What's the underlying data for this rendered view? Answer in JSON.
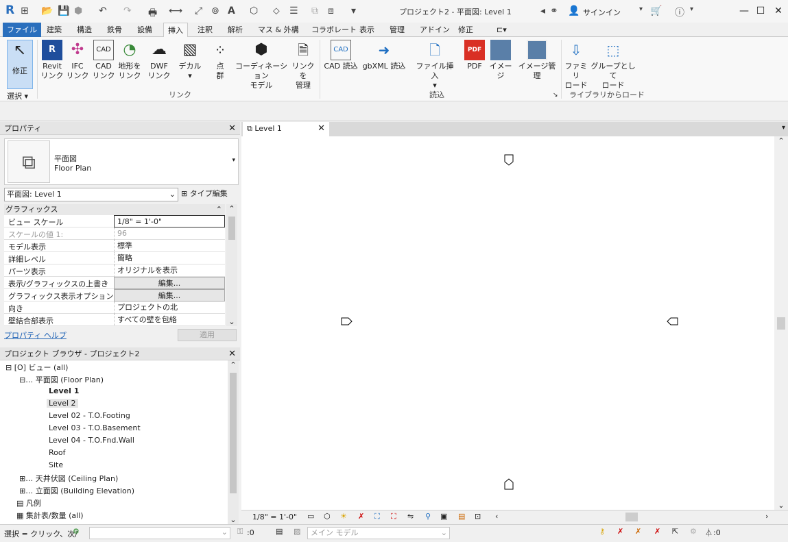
{
  "app": {
    "title": "プロジェクト2 - 平面図: Level 1",
    "signin": "サインイン",
    "logo": "R"
  },
  "tabs": [
    "ファイル",
    "建築",
    "構造",
    "鉄骨",
    "設備",
    "挿入",
    "注釈",
    "解析",
    "マス & 外構",
    "コラボレート",
    "表示",
    "管理",
    "アドイン",
    "修正"
  ],
  "ribbon": {
    "modify": "修正",
    "select": "選択",
    "links": [
      {
        "l1": "Revit",
        "l2": "リンク"
      },
      {
        "l1": "IFC",
        "l2": "リンク"
      },
      {
        "l1": "CAD",
        "l2": "リンク"
      },
      {
        "l1": "地形を",
        "l2": "リンク"
      },
      {
        "l1": "DWF",
        "l2": "リンク"
      },
      {
        "l1": "デカル",
        "l2": ""
      },
      {
        "l1": "点",
        "l2": "群"
      },
      {
        "l1": "コーディネーション",
        "l2": "モデル"
      },
      {
        "l1": "リンクを",
        "l2": "管理"
      }
    ],
    "link_panel": "リンク",
    "imports": [
      "CAD 読込",
      "gbXML 読込",
      "ファイル挿入",
      "PDF",
      "イメージ",
      "イメージ管理"
    ],
    "import_panel": "読込",
    "library": [
      {
        "l1": "ファミリ",
        "l2": "ロード"
      },
      {
        "l1": "グループとして",
        "l2": "ロード"
      }
    ],
    "library_panel": "ライブラリからロード"
  },
  "properties": {
    "title": "プロパティ",
    "type_l1": "平面図",
    "type_l2": "Floor Plan",
    "selector": "平面図: Level 1",
    "type_edit": "タイプ編集",
    "section": "グラフィックス",
    "rows": [
      {
        "k": "ビュー スケール",
        "v": "1/8\" = 1'-0\""
      },
      {
        "k": "スケールの値    1:",
        "v": "96"
      },
      {
        "k": "モデル表示",
        "v": "標準"
      },
      {
        "k": "詳細レベル",
        "v": "簡略"
      },
      {
        "k": "パーツ表示",
        "v": "オリジナルを表示"
      },
      {
        "k": "表示/グラフィックスの上書き",
        "v": "編集..."
      },
      {
        "k": "グラフィックス表示オプション",
        "v": "編集..."
      },
      {
        "k": "向き",
        "v": "プロジェクトの北"
      },
      {
        "k": "壁結合部表示",
        "v": "すべての壁を包絡"
      }
    ],
    "help": "プロパティ ヘルプ",
    "apply": "適用"
  },
  "browser": {
    "title": "プロジェクト ブラウザ - プロジェクト2",
    "views": "ビュー (all)",
    "floor_plan": "平面図 (Floor Plan)",
    "levels": [
      "Level 1",
      "Level 2",
      "Level 02 - T.O.Footing",
      "Level 03 - T.O.Basement",
      "Level 04 - T.O.Fnd.Wall",
      "Roof",
      "Site"
    ],
    "ceiling": "天井伏図 (Ceiling Plan)",
    "elevation": "立面図 (Building Elevation)",
    "legend": "凡例",
    "schedule": "集計表/数量 (all)"
  },
  "view": {
    "tab": "Level 1",
    "scale": "1/8\" = 1'-0\""
  },
  "status": {
    "hint": "選択 = クリック、次/",
    "filter_count": ":0",
    "model": "メイン モデル",
    "select_count": ":0"
  }
}
